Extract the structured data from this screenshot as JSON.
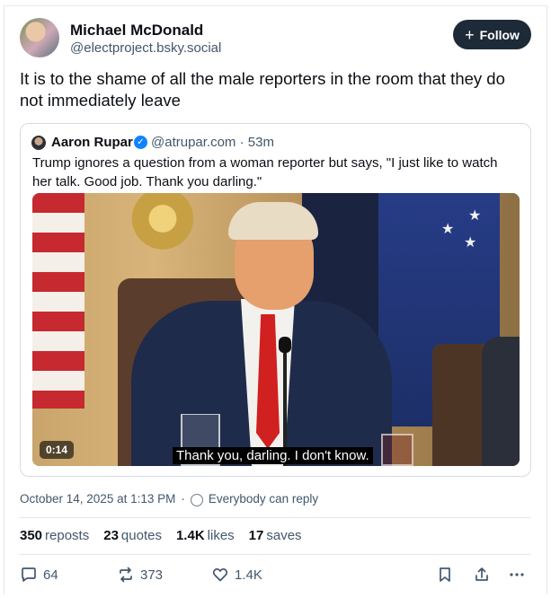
{
  "author": {
    "display_name": "Michael McDonald",
    "handle": "@electproject.bsky.social"
  },
  "follow_button": {
    "label": "Follow"
  },
  "post": {
    "text": "It is to the shame of all the male reporters in the room that they do not immediately leave",
    "timestamp": "October 14, 2025 at 1:13 PM",
    "reply_setting": "Everybody can reply"
  },
  "quoted_post": {
    "display_name": "Aaron Rupar",
    "handle": "@atrupar.com",
    "age": "53m",
    "text": "Trump ignores a question from a woman reporter but says, \"I just like to watch her talk. Good job. Thank you darling.\"",
    "video": {
      "duration": "0:14",
      "caption": "Thank you, darling. I don't know."
    }
  },
  "stats": {
    "reposts_count": "350",
    "reposts_label": "reposts",
    "quotes_count": "23",
    "quotes_label": "quotes",
    "likes_count": "1.4K",
    "likes_label": "likes",
    "saves_count": "17",
    "saves_label": "saves"
  },
  "actions": {
    "reply_count": "64",
    "repost_count": "373",
    "like_count": "1.4K"
  },
  "colors": {
    "follow_bg": "#1d2a38",
    "muted_text": "#42576c",
    "verified_blue": "#1083fe"
  },
  "icons": [
    "globe-icon",
    "verified-icon",
    "reply-icon",
    "repost-icon",
    "like-icon",
    "bookmark-icon",
    "share-icon",
    "more-icon"
  ]
}
